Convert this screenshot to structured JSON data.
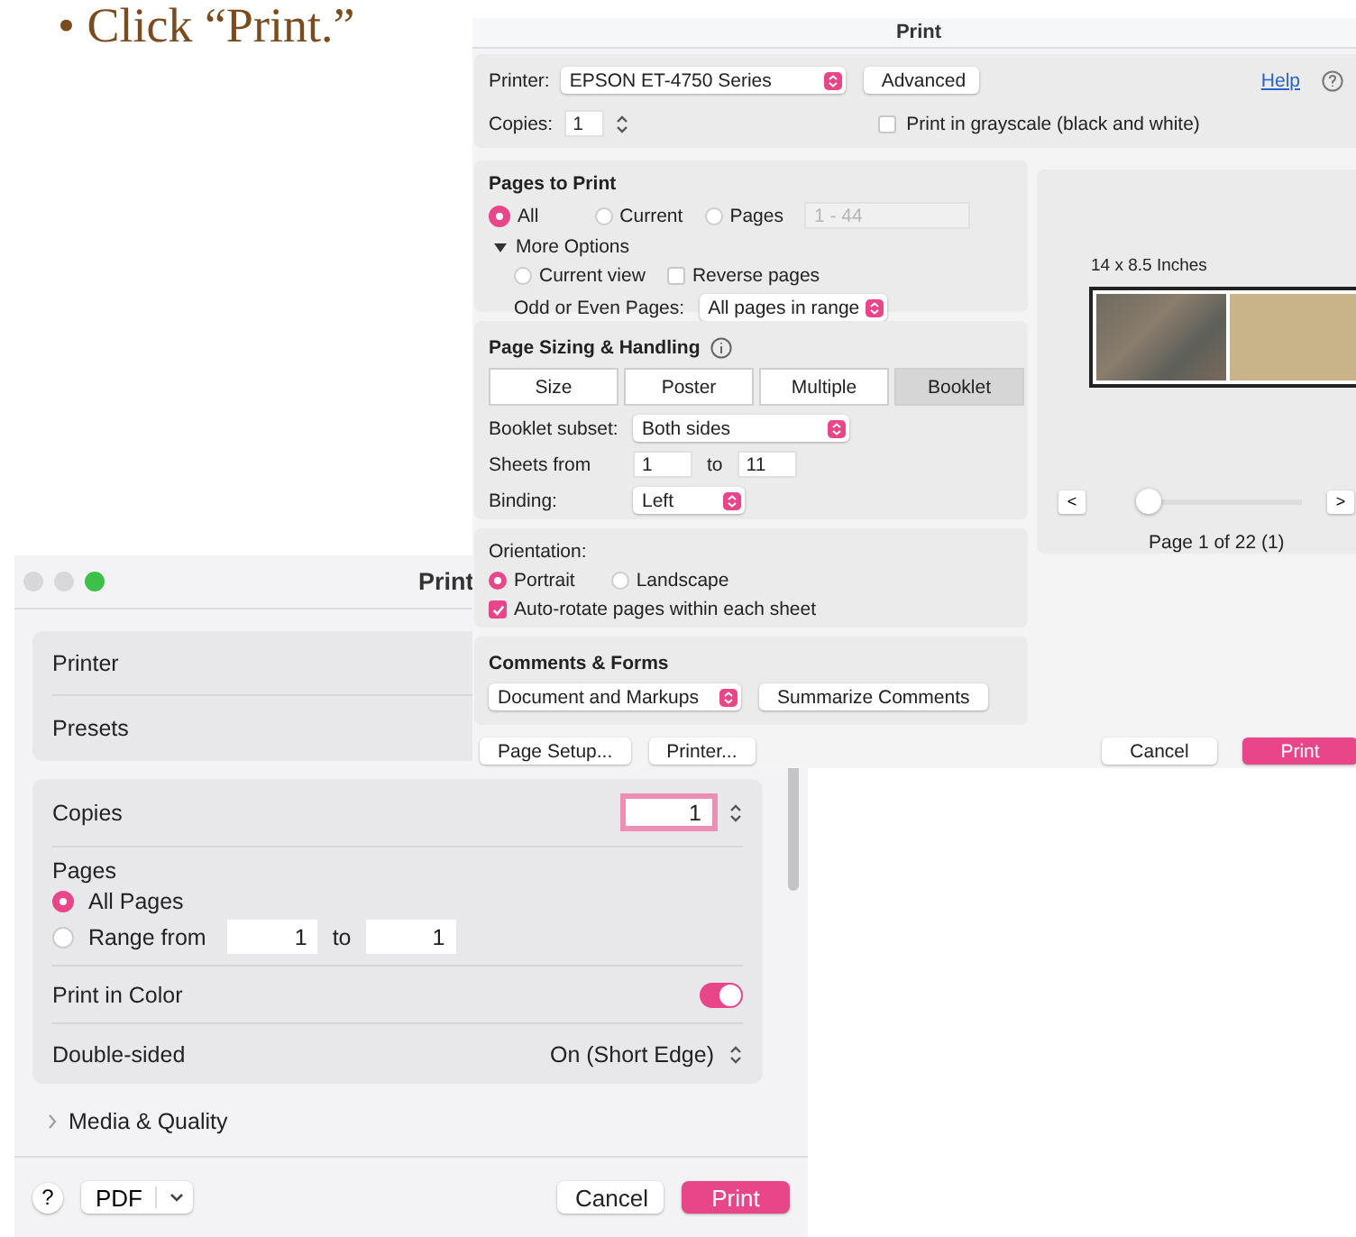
{
  "caption": "• Click “Print.”",
  "acrobat_dialog": {
    "title": "Print",
    "printer": {
      "label": "Printer:",
      "value": "EPSON ET-4750 Series"
    },
    "advanced_button": "Advanced",
    "help_link": "Help",
    "copies": {
      "label": "Copies:",
      "value": "1"
    },
    "grayscale": {
      "label": "Print in grayscale (black and white)",
      "checked": false
    },
    "pages_to_print": {
      "title": "Pages to Print",
      "options": [
        {
          "label": "All",
          "selected": true
        },
        {
          "label": "Current",
          "selected": false
        },
        {
          "label": "Pages",
          "selected": false
        }
      ],
      "pages_field": {
        "placeholder": "1 - 44"
      },
      "more_options": {
        "label": "More Options",
        "expanded": true
      },
      "current_view": {
        "label": "Current view",
        "selected": false
      },
      "reverse_pages": {
        "label": "Reverse pages",
        "checked": false
      },
      "odd_even": {
        "label": "Odd or Even Pages:",
        "value": "All pages in range"
      }
    },
    "page_sizing": {
      "title": "Page Sizing & Handling",
      "tabs": [
        {
          "label": "Size",
          "selected": false
        },
        {
          "label": "Poster",
          "selected": false
        },
        {
          "label": "Multiple",
          "selected": false
        },
        {
          "label": "Booklet",
          "selected": true
        }
      ],
      "booklet_subset": {
        "label": "Booklet subset:",
        "value": "Both sides"
      },
      "sheets": {
        "label": "Sheets from",
        "from": "1",
        "to_label": "to",
        "to": "11"
      },
      "binding": {
        "label": "Binding:",
        "value": "Left"
      }
    },
    "orientation": {
      "title": "Orientation:",
      "options": [
        {
          "label": "Portrait",
          "selected": true
        },
        {
          "label": "Landscape",
          "selected": false
        }
      ],
      "auto_rotate": {
        "label": "Auto-rotate pages within each sheet",
        "checked": true
      }
    },
    "comments": {
      "title": "Comments & Forms",
      "value": "Document and Markups",
      "summarize_button": "Summarize Comments"
    },
    "preview": {
      "size_label": "14 x 8.5 Inches",
      "prev_button": "<",
      "next_button": ">",
      "slider": {
        "level": 0
      },
      "page_label": "Page 1 of 22 (1)"
    },
    "footer_buttons": [
      {
        "label": "Page Setup..."
      },
      {
        "label": "Printer..."
      }
    ],
    "action_buttons": [
      {
        "label": "Cancel",
        "kind": "plain"
      },
      {
        "label": "Print",
        "kind": "primary"
      }
    ]
  },
  "mac_dialog": {
    "title": "Print",
    "top_rows": [
      {
        "label": "Printer"
      },
      {
        "label": "Presets"
      }
    ],
    "copies": {
      "label": "Copies",
      "value": "1"
    },
    "pages": {
      "label": "Pages",
      "options": [
        {
          "label": "All Pages",
          "selected": true
        },
        {
          "label": "Range from",
          "selected": false
        }
      ],
      "range_from": "1",
      "range_to_label": "to",
      "range_to": "1"
    },
    "print_in_color": {
      "label": "Print in Color",
      "on": true
    },
    "double_sided": {
      "label": "Double-sided",
      "value": "On (Short Edge)"
    },
    "media_quality": {
      "label": "Media & Quality",
      "expanded": false
    },
    "help_button": "?",
    "pdf_button": "PDF",
    "buttons": [
      {
        "label": "Cancel",
        "kind": "plain"
      },
      {
        "label": "Print",
        "kind": "primary"
      }
    ]
  }
}
